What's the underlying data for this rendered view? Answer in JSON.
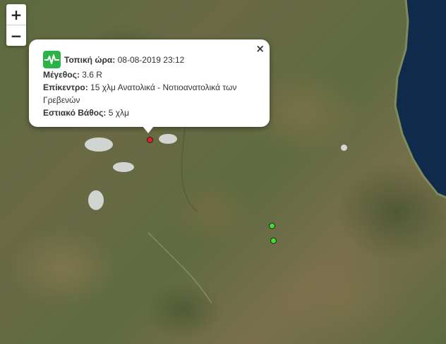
{
  "zoom": {
    "in_label": "+",
    "out_label": "−"
  },
  "popup": {
    "close_label": "×",
    "time_label": "Τοπική ώρα:",
    "time_value": "08-08-2019 23:12",
    "magnitude_label": "Μέγεθος:",
    "magnitude_value": "3.6 R",
    "epicenter_label": "Επίκεντρο:",
    "epicenter_value": "15 χλμ Ανατολικά - Νοτιοανατολικά των Γρεβενών",
    "depth_label": "Εστιακό Βάθος:",
    "depth_value": "5 χλμ"
  },
  "colors": {
    "selected_marker": "#e0201c",
    "other_marker": "#3fe02a",
    "icon_bg": "#2bb34a",
    "sea": "#0f2a4a"
  }
}
